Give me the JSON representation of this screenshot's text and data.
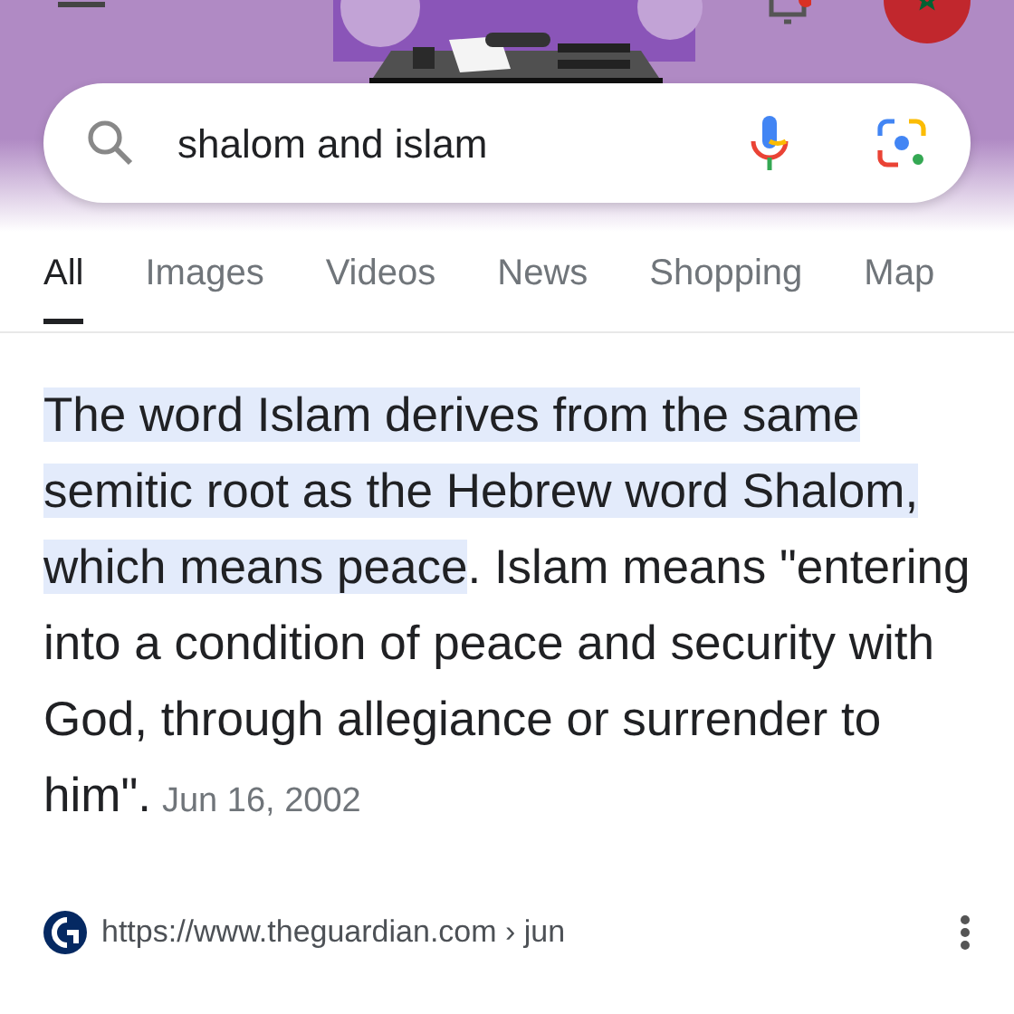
{
  "search": {
    "value": "shalom and islam"
  },
  "tabs": [
    {
      "label": "All",
      "selected": true
    },
    {
      "label": "Images",
      "selected": false
    },
    {
      "label": "Videos",
      "selected": false
    },
    {
      "label": "News",
      "selected": false
    },
    {
      "label": "Shopping",
      "selected": false
    },
    {
      "label": "Map",
      "selected": false
    }
  ],
  "snippet": {
    "highlight": "The word Islam derives from the same semitic root as the Hebrew word Shalom, which means peace",
    "rest": ". Islam means \"entering into a condition of peace and security with God, through allegiance or surrender to him\".",
    "date": "Jun 16, 2002"
  },
  "source": {
    "url": "https://www.theguardian.com › jun"
  }
}
